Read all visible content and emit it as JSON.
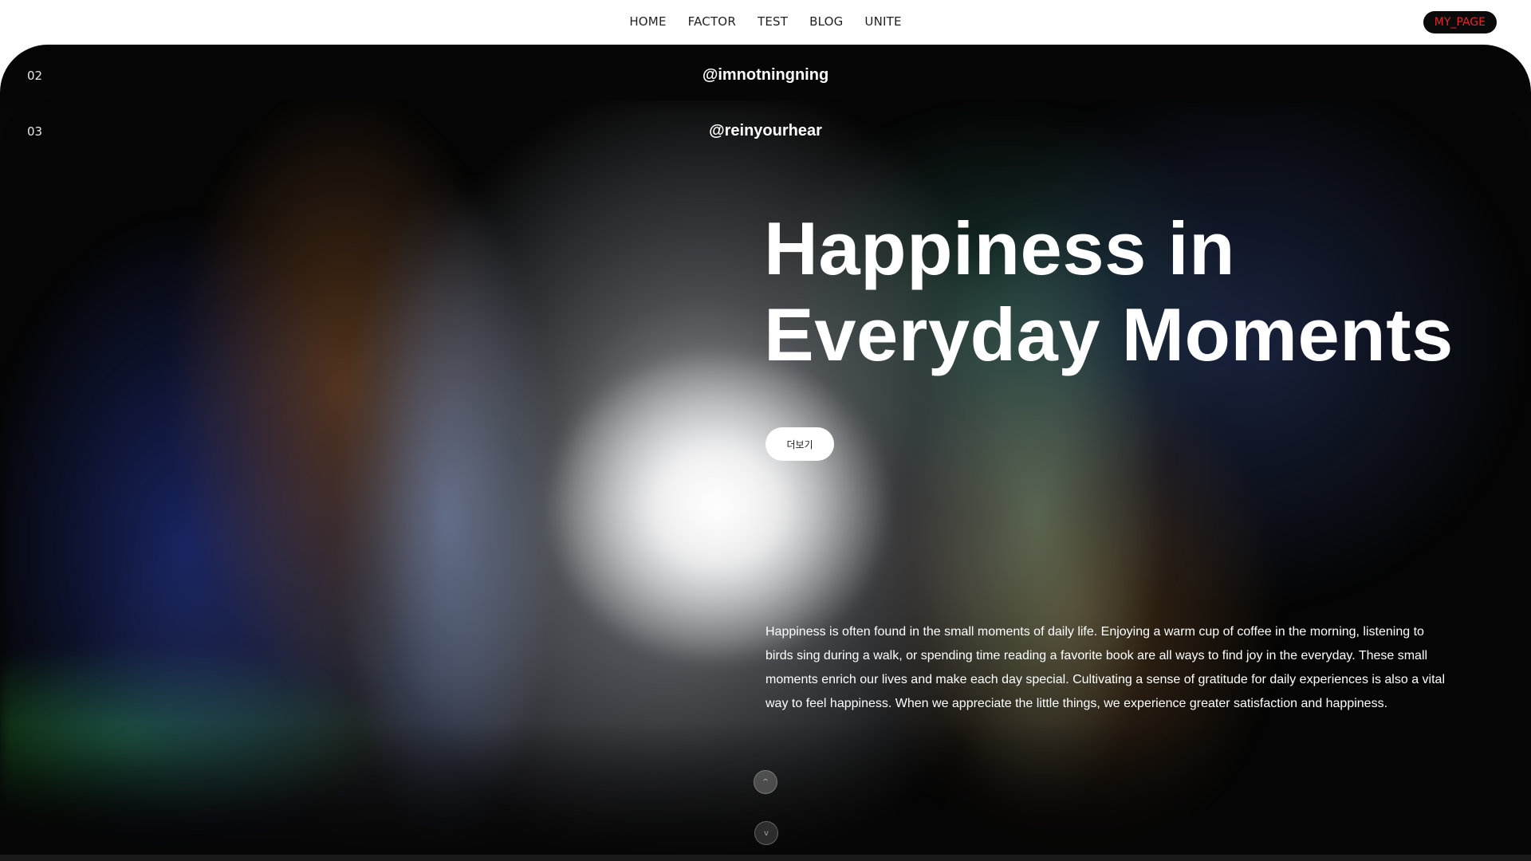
{
  "nav": {
    "links": [
      "HOME",
      "FACTOR",
      "TEST",
      "BLOG",
      "UNITE"
    ],
    "mypage_label": "MY_PAGE"
  },
  "cards": [
    {
      "number": "02",
      "handle": "@imnotningning"
    },
    {
      "number": "03",
      "handle": "@reinyourhear"
    }
  ],
  "hero": {
    "title_line1": "Happiness in",
    "title_line2": "Everyday Moments",
    "more_label": "더보기",
    "body": "Happiness is often found in the small moments of daily life. Enjoying a warm cup of coffee in the morning, listening to birds sing during a walk, or spending time reading a favorite book are all ways to find joy in the everyday. These small moments enrich our lives and make each day special. Cultivating a sense of gratitude for daily experiences is also a vital way to feel happiness. When we appreciate the little things, we experience greater satisfaction and happiness."
  },
  "controls": {
    "scroll_up_icon": "^",
    "scroll_down_icon": "v"
  },
  "colors": {
    "mypage_text": "#e02b2b",
    "mypage_bg": "#0a0a0a"
  }
}
